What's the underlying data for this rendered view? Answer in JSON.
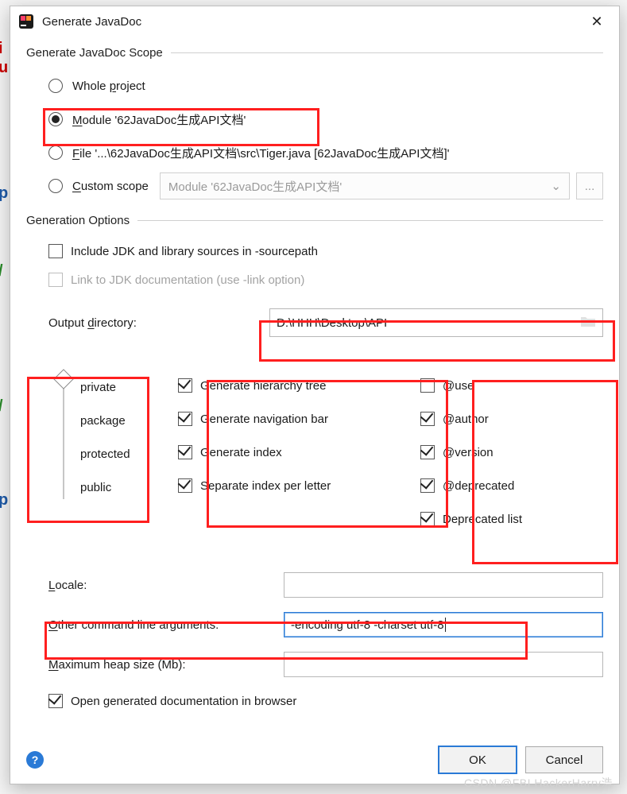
{
  "title": "Generate JavaDoc",
  "section_scope": "Generate JavaDoc Scope",
  "scope": {
    "whole_project": "Whole project",
    "module": "Module '62JavaDoc生成API文档'",
    "file": "File '...\\62JavaDoc生成API文档\\src\\Tiger.java [62JavaDoc生成API文档]'",
    "custom": "Custom scope",
    "custom_combo": "Module '62JavaDoc生成API文档'",
    "ellipsis": "..."
  },
  "section_gen": "Generation Options",
  "gen": {
    "include_jdk": "Include JDK and library sources in -sourcepath",
    "link_jdk": "Link to JDK documentation (use -link option)",
    "output_label": "Output directory:",
    "output_value": "D:\\HHH\\Desktop\\API"
  },
  "visibility": {
    "private": "private",
    "package": "package",
    "protected": "protected",
    "public": "public"
  },
  "midcol": {
    "tree": "Generate hierarchy tree",
    "nav": "Generate navigation bar",
    "index": "Generate index",
    "sep": "Separate index per letter"
  },
  "rightcol": {
    "use": "@use",
    "author": "@author",
    "version": "@version",
    "deprecated": "@deprecated",
    "deplist": "Deprecated list"
  },
  "fields": {
    "locale_label": "Locale:",
    "locale_value": "",
    "args_label": "Other command line arguments:",
    "args_value": "-encoding utf-8 -charset utf-8",
    "heap_label": "Maximum heap size (Mb):",
    "heap_value": "",
    "open_browser": "Open generated documentation in browser"
  },
  "buttons": {
    "ok": "OK",
    "cancel": "Cancel"
  },
  "watermark": "CSDN @FBI HackerHarry浩",
  "bgcode": {
    "a": "i",
    "b": "u",
    "c": "p",
    "d": "/",
    "e": "/",
    "f": "p"
  }
}
